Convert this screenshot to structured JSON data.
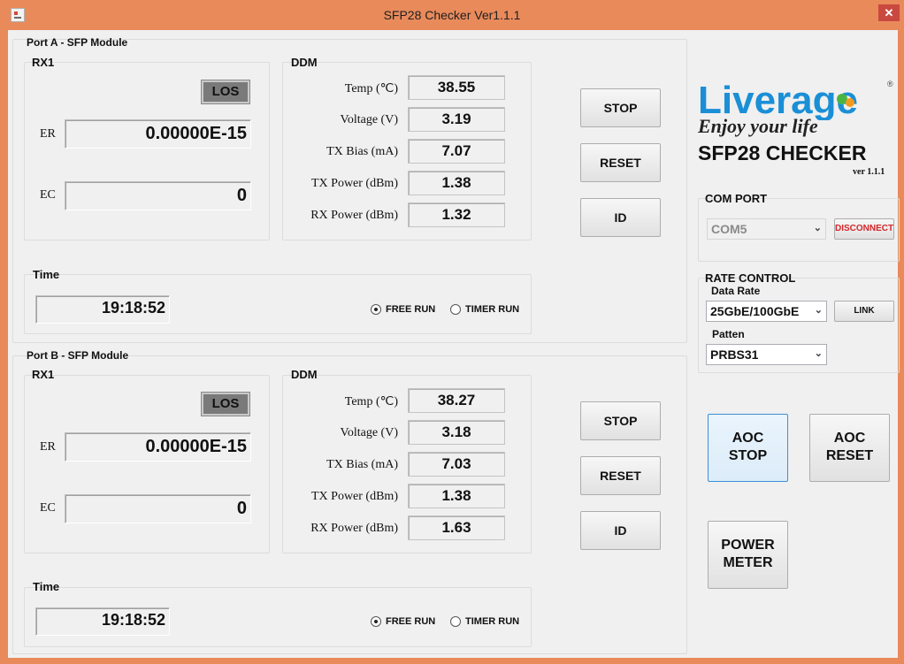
{
  "window": {
    "title": "SFP28 Checker Ver1.1.1",
    "close_glyph": "✕"
  },
  "ports": [
    {
      "group_label": "Port A - SFP Module",
      "rx_label": "RX1",
      "los_label": "LOS",
      "er_label": "ER",
      "er_value": "0.00000E-15",
      "ec_label": "EC",
      "ec_value": "0",
      "ddm_label": "DDM",
      "ddm": [
        {
          "label": "Temp (℃)",
          "value": "38.55"
        },
        {
          "label": "Voltage (V)",
          "value": "3.19"
        },
        {
          "label": "TX Bias (mA)",
          "value": "7.07"
        },
        {
          "label": "TX Power (dBm)",
          "value": "1.38"
        },
        {
          "label": "RX Power (dBm)",
          "value": "1.32"
        }
      ],
      "buttons": {
        "stop": "STOP",
        "reset": "RESET",
        "id": "ID"
      },
      "time_label": "Time",
      "time_value": "19:18:52",
      "radio_free": "FREE RUN",
      "radio_timer": "TIMER RUN",
      "mode_selected": "FREE RUN"
    },
    {
      "group_label": "Port B - SFP Module",
      "rx_label": "RX1",
      "los_label": "LOS",
      "er_label": "ER",
      "er_value": "0.00000E-15",
      "ec_label": "EC",
      "ec_value": "0",
      "ddm_label": "DDM",
      "ddm": [
        {
          "label": "Temp (℃)",
          "value": "38.27"
        },
        {
          "label": "Voltage (V)",
          "value": "3.18"
        },
        {
          "label": "TX Bias (mA)",
          "value": "7.03"
        },
        {
          "label": "TX Power (dBm)",
          "value": "1.38"
        },
        {
          "label": "RX Power (dBm)",
          "value": "1.63"
        }
      ],
      "buttons": {
        "stop": "STOP",
        "reset": "RESET",
        "id": "ID"
      },
      "time_label": "Time",
      "time_value": "19:18:52",
      "radio_free": "FREE RUN",
      "radio_timer": "TIMER RUN",
      "mode_selected": "FREE RUN"
    }
  ],
  "logo": {
    "brand": "Liverage",
    "registered": "®",
    "tagline": "Enjoy your life",
    "product": "SFP28 CHECKER",
    "version": "ver 1.1.1",
    "colors": {
      "blue": "#1b8fd6",
      "orange": "#f39a1e",
      "green": "#4bb543",
      "dark": "#222222"
    }
  },
  "com_port": {
    "label": "COM PORT",
    "selected": "COM5",
    "disconnect": "DISCONNECT"
  },
  "rate_control": {
    "label": "RATE CONTROL",
    "data_rate_label": "Data Rate",
    "data_rate_selected": "25GbE/100GbE",
    "link": "LINK",
    "pattern_label": "Patten",
    "pattern_selected": "PRBS31"
  },
  "aoc": {
    "stop_line1": "AOC",
    "stop_line2": "STOP",
    "reset_line1": "AOC",
    "reset_line2": "RESET",
    "power_line1": "POWER",
    "power_line2": "METER"
  },
  "colors": {
    "title_bar": "#e98a5b",
    "window_bg": "#f0f0f0",
    "los_bg": "#7a7a7a",
    "disconnect_text": "#d2272b"
  }
}
